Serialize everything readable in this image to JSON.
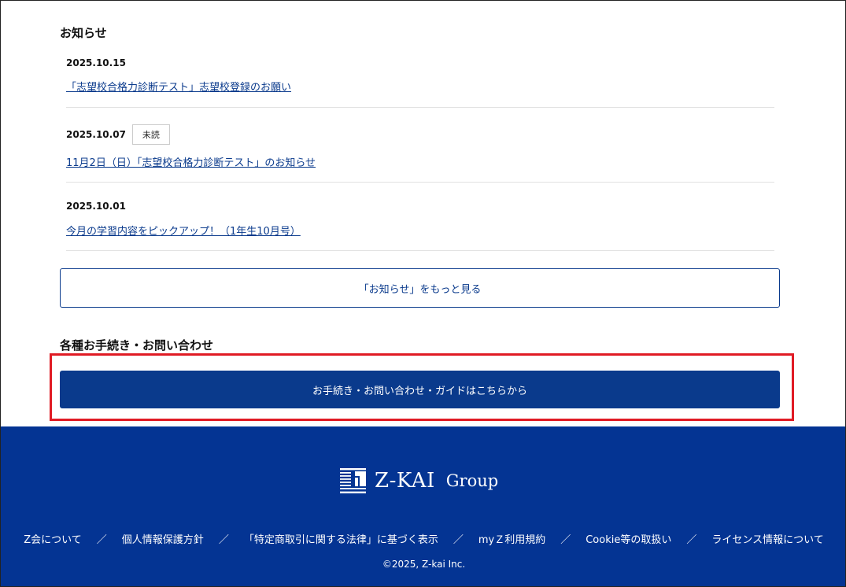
{
  "news": {
    "title": "お知らせ",
    "items": [
      {
        "date": "2025.10.15",
        "badge": "",
        "title": "「志望校合格力診断テスト」志望校登録のお願い"
      },
      {
        "date": "2025.10.07",
        "badge": "未読",
        "title": "11月2日（日）「志望校合格力診断テスト」のお知らせ"
      },
      {
        "date": "2025.10.01",
        "badge": "",
        "title": "今月の学習内容をピックアップ！（1年生10月号）"
      }
    ],
    "more_label": "「お知らせ」をもっと見る"
  },
  "procedures": {
    "title": "各種お手続き・お問い合わせ",
    "button_label": "お手続き・お問い合わせ・ガイドはこちらから"
  },
  "footer": {
    "logo_text": "Z-KAI",
    "logo_group": "Group",
    "links": [
      "Z会について",
      "個人情報保護方針",
      "「特定商取引に関する法律」に基づく表示",
      "myＺ利用規約",
      "Cookie等の取扱い",
      "ライセンス情報について"
    ],
    "separator": "／",
    "copyright": "©2025, Z-kai Inc."
  },
  "colors": {
    "brand_navy": "#043493",
    "link_blue": "#0a3a8c",
    "highlight_red": "#e01b24"
  }
}
